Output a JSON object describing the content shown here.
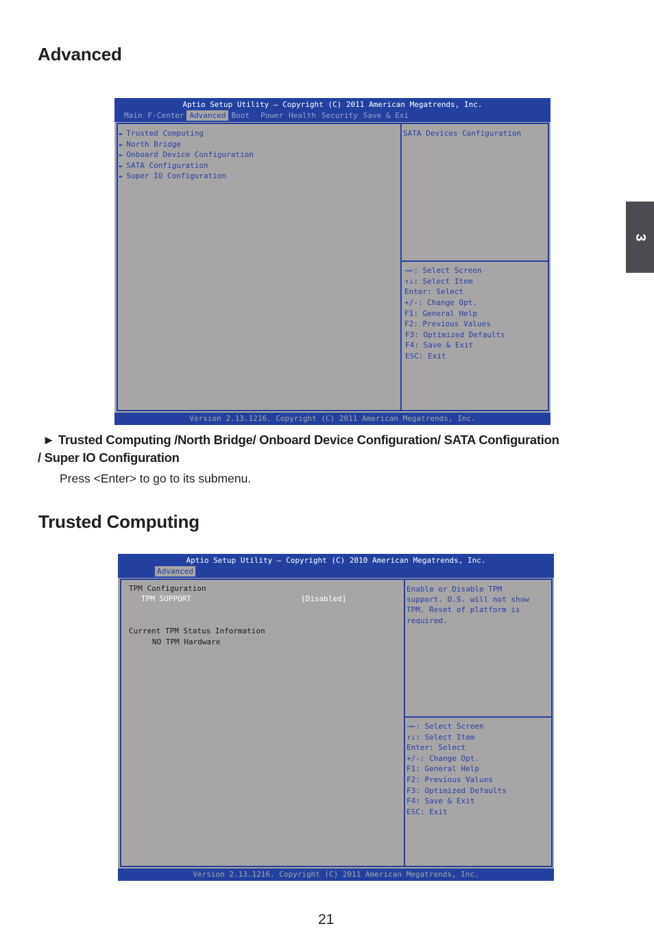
{
  "page": {
    "heading_advanced": "Advanced",
    "heading_trusted": "Trusted Computing",
    "chapter_tab": "3",
    "page_number": "21",
    "description_title_line1": "► Trusted Computing /North Bridge/ Onboard Device Configuration/ SATA  Configuration",
    "description_title_line2": "/ Super IO Configuration",
    "description_body": "Press <Enter> to go to its submenu."
  },
  "screen1": {
    "title": "Aptio Setup Utility – Copyright (C) 2011 American Megatrends, Inc.",
    "tabs": [
      {
        "label": "Main",
        "active": false
      },
      {
        "label": "F-Center",
        "active": false
      },
      {
        "label": "Advanced",
        "active": true
      },
      {
        "label": "Boot",
        "active": false
      },
      {
        "label": "Power",
        "active": false
      },
      {
        "label": "Health",
        "active": false
      },
      {
        "label": "Security",
        "active": false
      },
      {
        "label": "Save & Exi",
        "active": false
      }
    ],
    "menu_items": [
      {
        "label": "Trusted Computing",
        "icon": "submenu-arrow-icon"
      },
      {
        "label": "North Bridge",
        "icon": "submenu-arrow-icon"
      },
      {
        "label": "Onboard Device Configuration",
        "icon": "submenu-arrow-icon"
      },
      {
        "label": "SATA Configuration",
        "icon": "submenu-arrow-icon"
      },
      {
        "label": "Super IO Configuration",
        "icon": "submenu-arrow-icon"
      }
    ],
    "help_text": "SATA Devices Configuration",
    "keys": [
      "→←: Select Screen",
      "↑↓: Select Item",
      "Enter: Select",
      "+/-: Change Opt.",
      "F1: General Help",
      "F2: Previous Values",
      "F3: Optimized Defaults",
      "F4: Save & Exit",
      "ESC: Exit"
    ],
    "footer": "Version 2.13.1216. Copyright (C) 2011 American Megatrends, Inc."
  },
  "screen2": {
    "title": "Aptio Setup Utility – Copyright (C) 2010 American Megatrends, Inc.",
    "active_tab": "Advanced",
    "section1_label": "TPM Configuration",
    "option_label": "TPM SUPPORT",
    "option_value": "[Disabled]",
    "section2_label": "Current TPM Status Information",
    "status_value": "NO TPM Hardware",
    "help_lines": [
      "Enable or Disable TPM",
      "support. O.S. will not show",
      "TPM. Reset of platform is",
      "required."
    ],
    "keys": [
      "→←: Select Screen",
      "↑↓: Select Item",
      "Enter: Select",
      "+/-: Change Opt.",
      "F1: General Help",
      "F2: Previous Values",
      "F3: Optimized Defaults",
      "F4: Save & Exit",
      "ESC: Exit"
    ],
    "footer": "Version 2.13.1216. Copyright (C) 2011 American Megatrends, Inc."
  }
}
